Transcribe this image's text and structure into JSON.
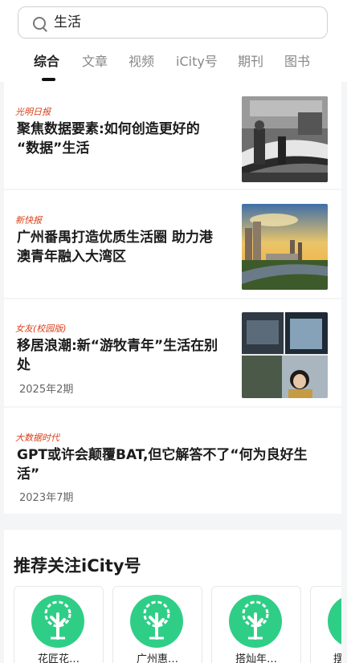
{
  "search": {
    "query": "生活"
  },
  "tabs": [
    {
      "label": "综合",
      "active": true
    },
    {
      "label": "文章"
    },
    {
      "label": "视频"
    },
    {
      "label": "iCity号"
    },
    {
      "label": "期刊"
    },
    {
      "label": "图书"
    }
  ],
  "results": [
    {
      "source": "光明日报",
      "title_line1": "聚焦数据要素:如何创造更好的",
      "title_line2": "“数据”生活",
      "thumb": "exhibition-photo"
    },
    {
      "source": "新快报",
      "title_line1": "广州番禺打造优质生活圈 助力港",
      "title_line2": "澳青年融入大湾区",
      "thumb": "city-skyline-photo"
    },
    {
      "source": "女友(校园版)",
      "title_line1": "移居浪潮:新“游牧青年”生活在别",
      "title_line2": "处",
      "date": "2025年2期",
      "thumb": "magazine-collage-photo"
    },
    {
      "source": "大数据时代",
      "title_line1": "GPT或许会颠覆BAT,但它解答不了“何为良好生",
      "title_line2": "活”",
      "date": "2023年7期"
    }
  ],
  "recommend": {
    "title": "推荐关注iCity号",
    "accounts": [
      {
        "name": "花匠花…"
      },
      {
        "name": "广州惠…"
      },
      {
        "name": "搭灿年…"
      },
      {
        "name": "摆"
      }
    ]
  },
  "colors": {
    "source_red": "#d8401a",
    "logo_green": "#2fce86"
  }
}
